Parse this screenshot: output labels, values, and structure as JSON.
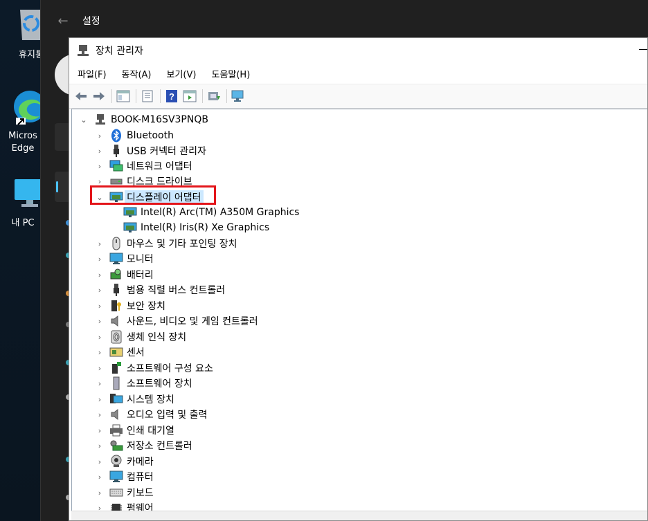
{
  "desktop": {
    "icons": [
      {
        "label": "휴지통",
        "name": "recycle-bin-icon"
      },
      {
        "label": "Microsoft Edge",
        "name": "edge-icon"
      },
      {
        "label": "내 PC",
        "name": "this-pc-icon"
      }
    ]
  },
  "settings": {
    "title": "설정",
    "back_label": "←"
  },
  "device_manager": {
    "title": "장치 관리자",
    "menu": [
      "파일(F)",
      "동작(A)",
      "보기(V)",
      "도움말(H)"
    ],
    "toolbar": [
      "back-arrow-icon",
      "forward-arrow-icon",
      "show-hide-console-tree-icon",
      "properties-icon",
      "help-icon",
      "action-pane-icon",
      "update-driver-icon",
      "scan-hardware-changes-icon"
    ],
    "root": "BOOK-M16SV3PNQB",
    "categories": [
      {
        "label": "Bluetooth",
        "icon": "bluetooth-icon"
      },
      {
        "label": "USB 커넥터 관리자",
        "icon": "usb-icon"
      },
      {
        "label": "네트워크 어댑터",
        "icon": "network-icon"
      },
      {
        "label": "디스크 드라이브",
        "icon": "disk-drive-icon"
      },
      {
        "label": "디스플레이 어댑터",
        "icon": "display-adapter-icon",
        "expanded": true,
        "selected": true,
        "children": [
          "Intel(R) Arc(TM) A350M Graphics",
          "Intel(R) Iris(R) Xe Graphics"
        ]
      },
      {
        "label": "마우스 및 기타 포인팅 장치",
        "icon": "mouse-icon"
      },
      {
        "label": "모니터",
        "icon": "monitor-icon"
      },
      {
        "label": "배터리",
        "icon": "battery-icon"
      },
      {
        "label": "범용 직렬 버스 컨트롤러",
        "icon": "usb-controller-icon"
      },
      {
        "label": "보안 장치",
        "icon": "security-device-icon"
      },
      {
        "label": "사운드, 비디오 및 게임 컨트롤러",
        "icon": "sound-icon"
      },
      {
        "label": "생체 인식 장치",
        "icon": "biometric-icon"
      },
      {
        "label": "센서",
        "icon": "sensor-icon"
      },
      {
        "label": "소프트웨어 구성 요소",
        "icon": "software-component-icon"
      },
      {
        "label": "소프트웨어 장치",
        "icon": "software-device-icon"
      },
      {
        "label": "시스템 장치",
        "icon": "system-device-icon"
      },
      {
        "label": "오디오 입력 및 출력",
        "icon": "audio-io-icon"
      },
      {
        "label": "인쇄 대기열",
        "icon": "print-queue-icon"
      },
      {
        "label": "저장소 컨트롤러",
        "icon": "storage-controller-icon"
      },
      {
        "label": "카메라",
        "icon": "camera-icon"
      },
      {
        "label": "컴퓨터",
        "icon": "computer-icon"
      },
      {
        "label": "키보드",
        "icon": "keyboard-icon"
      },
      {
        "label": "펌웨어",
        "icon": "firmware-icon"
      }
    ]
  },
  "colors": {
    "highlight": "#e3151a",
    "selection": "#cce8ff",
    "accent": "#4cc2ff"
  }
}
